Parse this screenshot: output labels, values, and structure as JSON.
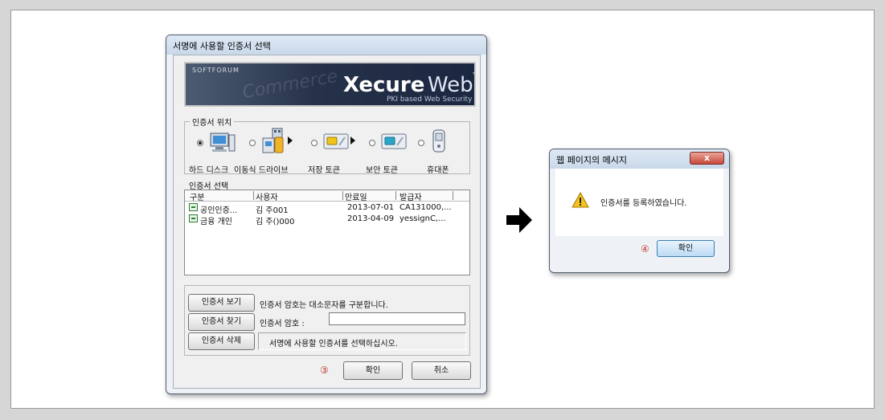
{
  "left_dialog": {
    "title": "서명에 사용할 인증서 선택",
    "banner": {
      "brand_small": "SOFTFORUM",
      "product_bold": "Xecure",
      "product_light": "Web",
      "trademark": "™",
      "subtitle": "PKI based Web Security Solution",
      "background_text": "Commerce"
    },
    "location_group_label": "인증서 위치",
    "locations": [
      {
        "label": "하드 디스크",
        "icon": "hard-disk-icon",
        "selected": true
      },
      {
        "label": "이동식 드라이브",
        "icon": "removable-drive-icon",
        "selected": false
      },
      {
        "label": "저장 토큰",
        "icon": "storage-token-icon",
        "selected": false
      },
      {
        "label": "보안 토큰",
        "icon": "security-token-icon",
        "selected": false
      },
      {
        "label": "휴대폰",
        "icon": "mobile-phone-icon",
        "selected": false
      }
    ],
    "select_label": "인증서 선택",
    "columns": [
      "구분",
      "사용자",
      "만료일",
      "발급자"
    ],
    "rows": [
      {
        "type": "공인인증...",
        "user": "김  주001",
        "expiry": "2013-07-01",
        "issuer": "CA131000,..."
      },
      {
        "type": "금융 개인",
        "user": "김  주()000",
        "expiry": "2013-04-09",
        "issuer": "yessignC,..."
      }
    ],
    "buttons": {
      "view": "인증서 보기",
      "find": "인증서 찾기",
      "delete": "인증서 삭제",
      "ok": "확인",
      "cancel": "취소"
    },
    "case_note": "인증서 암호는 대소문자를 구분합니다.",
    "password_label": "인증서 암호 :",
    "password_value": "",
    "status_text": "서명에 사용할 인증서를 선택하십시오.",
    "step_marker": "③"
  },
  "right_dialog": {
    "title": "웹 페이지의 메시지",
    "close_glyph": "x",
    "message": "인증서를 등록하였습니다.",
    "ok_button": "확인",
    "step_marker": "④"
  }
}
